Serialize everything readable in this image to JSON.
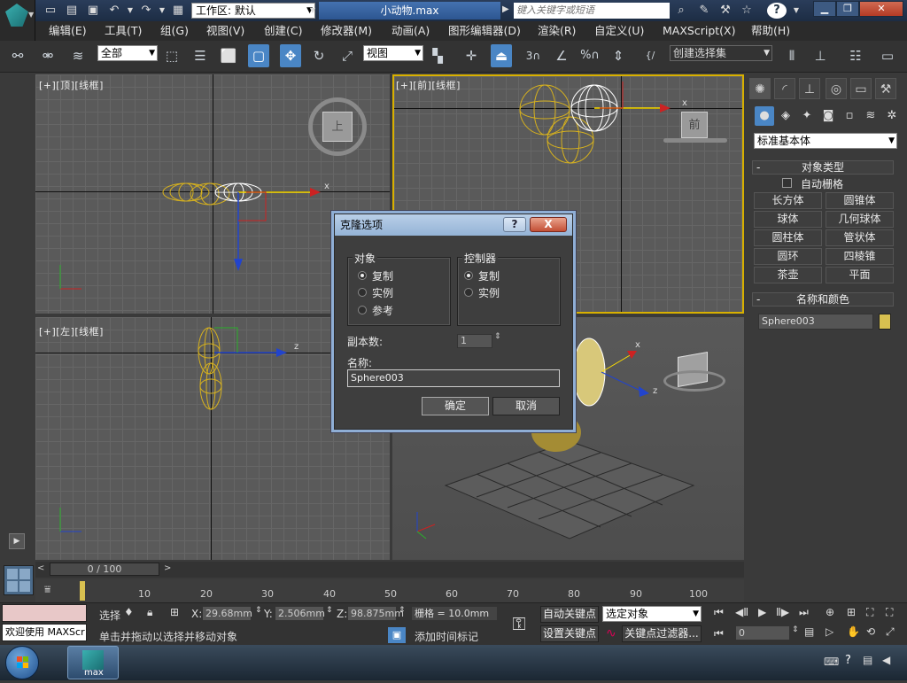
{
  "titlebar": {
    "workspace_value": "工作区: 默认",
    "doc_title": "小动物.max",
    "search_placeholder": "键入关键字或短语"
  },
  "menu": [
    "编辑(E)",
    "工具(T)",
    "组(G)",
    "视图(V)",
    "创建(C)",
    "修改器(M)",
    "动画(A)",
    "图形编辑器(D)",
    "渲染(R)",
    "自定义(U)",
    "MAXScript(X)",
    "帮助(H)"
  ],
  "toolbar": {
    "selection_filter": "全部",
    "ref_coord": "视图",
    "named_selection": "创建选择集"
  },
  "viewports": {
    "top_label": "[+][顶][线框]",
    "front_label": "[+][前][线框]",
    "left_label": "[+][左][线框]",
    "top_cube": "上",
    "front_cube": "前"
  },
  "command_panel": {
    "category": "标准基本体",
    "object_type_header": "对象类型",
    "autogrid": "自动栅格",
    "object_buttons": [
      "长方体",
      "圆锥体",
      "球体",
      "几何球体",
      "圆柱体",
      "管状体",
      "圆环",
      "四棱锥",
      "茶壶",
      "平面"
    ],
    "name_color_header": "名称和颜色",
    "object_name": "Sphere003",
    "object_color": "#d8c050"
  },
  "timeline": {
    "frame": "0 / 100",
    "ticks": [
      "10",
      "20",
      "30",
      "40",
      "50",
      "60",
      "70",
      "80",
      "90",
      "100"
    ]
  },
  "status": {
    "welcome": "欢迎使用 MAXScr",
    "select_label": "选择",
    "x_label": "X:",
    "x_value": "29.68mm",
    "y_label": "Y:",
    "y_value": "2.506mm",
    "z_label": "Z:",
    "z_value": "98.875mm",
    "grid": "栅格 = 10.0mm",
    "prompt": "单击并拖动以选择并移动对象",
    "add_time_tag": "添加时间标记",
    "auto_key": "自动关键点",
    "set_key": "设置关键点",
    "key_mode": "选定对象",
    "key_filters": "关键点过滤器...",
    "frame_field": "0"
  },
  "dialog": {
    "title": "克隆选项",
    "object_group": "对象",
    "object_options": [
      "复制",
      "实例",
      "参考"
    ],
    "object_selected": 0,
    "controller_group": "控制器",
    "controller_options": [
      "复制",
      "实例"
    ],
    "controller_selected": 0,
    "copies_label": "副本数:",
    "copies_value": "1",
    "name_label": "名称:",
    "name_value": "Sphere003",
    "ok": "确定",
    "cancel": "取消",
    "help": "?",
    "close": "X"
  },
  "taskbar": {
    "app_label": "max"
  },
  "colors": {
    "accent": "#4a86c5",
    "sphere_wire": "#d6b11e",
    "selected_wire": "#ffffff",
    "axis_x": "#cc2222",
    "axis_y": "#2ab02a",
    "axis_z": "#2244cc",
    "gizmo_x": "#ffe000"
  }
}
